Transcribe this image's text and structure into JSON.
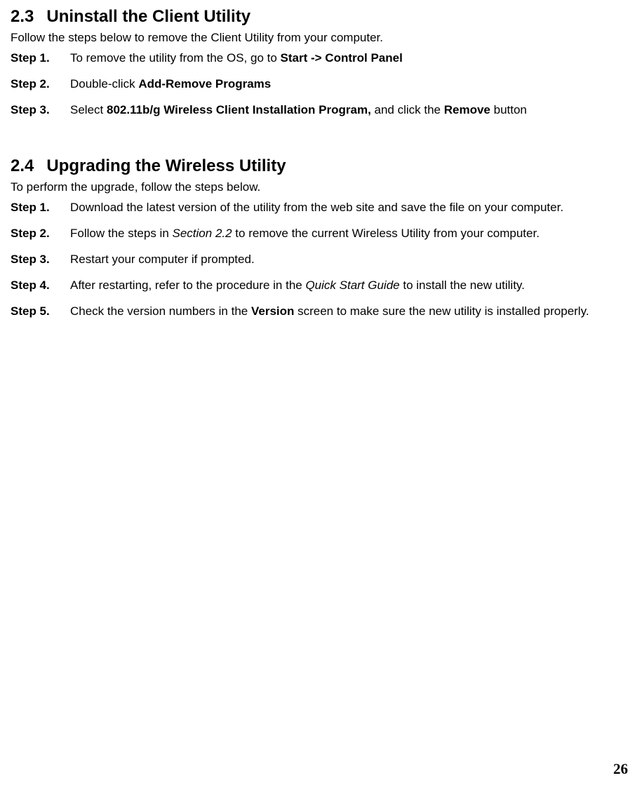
{
  "section23": {
    "number": "2.3",
    "title": "Uninstall the Client Utility",
    "intro": "Follow the steps below to remove the Client Utility from your computer.",
    "steps": [
      {
        "label": "Step 1.",
        "pre": "To remove the utility from the OS, go to ",
        "bold": "Start -> Control Panel"
      },
      {
        "label": "Step 2.",
        "pre": "Double-click ",
        "bold": "Add-Remove Programs"
      },
      {
        "label": "Step 3.",
        "pre": "Select ",
        "bold1": "802.11b/g Wireless Client Installation Program,",
        "mid": " and click the ",
        "bold2": "Remove",
        "post": " button"
      }
    ]
  },
  "section24": {
    "number": "2.4",
    "title": "Upgrading the Wireless Utility",
    "intro": "To perform the upgrade, follow the steps below.",
    "steps": [
      {
        "label": "Step 1.",
        "text": "Download the latest version of the utility from the web site and save the file on your computer."
      },
      {
        "label": "Step 2.",
        "pre": "Follow the steps in ",
        "italic": "Section 2.2",
        "post": " to remove the current Wireless Utility from your computer."
      },
      {
        "label": "Step 3.",
        "text": "Restart your computer if prompted."
      },
      {
        "label": "Step 4.",
        "pre": "After restarting, refer to the procedure in the ",
        "italic": "Quick Start Guide",
        "post": " to install the new utility."
      },
      {
        "label": "Step 5.",
        "pre": "Check the version numbers in the ",
        "bold": "Version",
        "post": " screen to make sure the new utility is installed properly."
      }
    ]
  },
  "pageNumber": "26"
}
